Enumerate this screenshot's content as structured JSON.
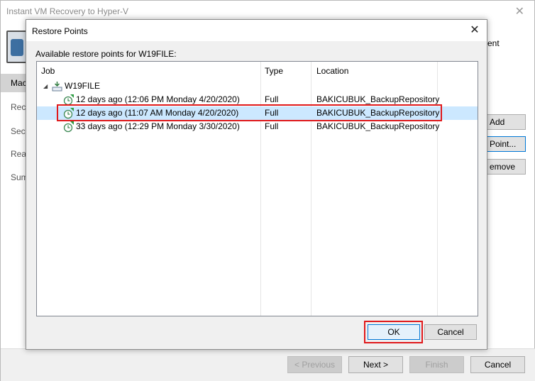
{
  "wizard": {
    "title": "Instant VM Recovery to Hyper-V",
    "header_text": "ent",
    "sidebar": [
      {
        "label": "Mac",
        "active": true
      },
      {
        "label": "Reco",
        "active": false
      },
      {
        "label": "Secu",
        "active": false
      },
      {
        "label": "Reas",
        "active": false
      },
      {
        "label": "Sum",
        "active": false
      }
    ],
    "side_buttons": [
      "Add",
      "Point...",
      "emove"
    ],
    "footer_buttons": {
      "previous": "< Previous",
      "next": "Next >",
      "finish": "Finish",
      "cancel": "Cancel"
    }
  },
  "dialog": {
    "title": "Restore Points",
    "close": "✕",
    "label": "Available restore points for W19FILE:",
    "columns": [
      "Job",
      "Type",
      "Location"
    ],
    "vm": "W19FILE",
    "restore_points": [
      {
        "job": "12 days ago (12:06 PM Monday 4/20/2020)",
        "type": "Full",
        "location": "BAKICUBUK_BackupRepository",
        "selected": false
      },
      {
        "job": "12 days ago (11:07 AM Monday 4/20/2020)",
        "type": "Full",
        "location": "BAKICUBUK_BackupRepository",
        "selected": true
      },
      {
        "job": "33 days ago (12:29 PM Monday 3/30/2020)",
        "type": "Full",
        "location": "BAKICUBUK_BackupRepository",
        "selected": false
      }
    ],
    "ok": "OK",
    "cancel": "Cancel"
  },
  "colors": {
    "selection": "#cce8ff",
    "highlight_box": "#e0191b",
    "focus_border": "#0078d7"
  }
}
